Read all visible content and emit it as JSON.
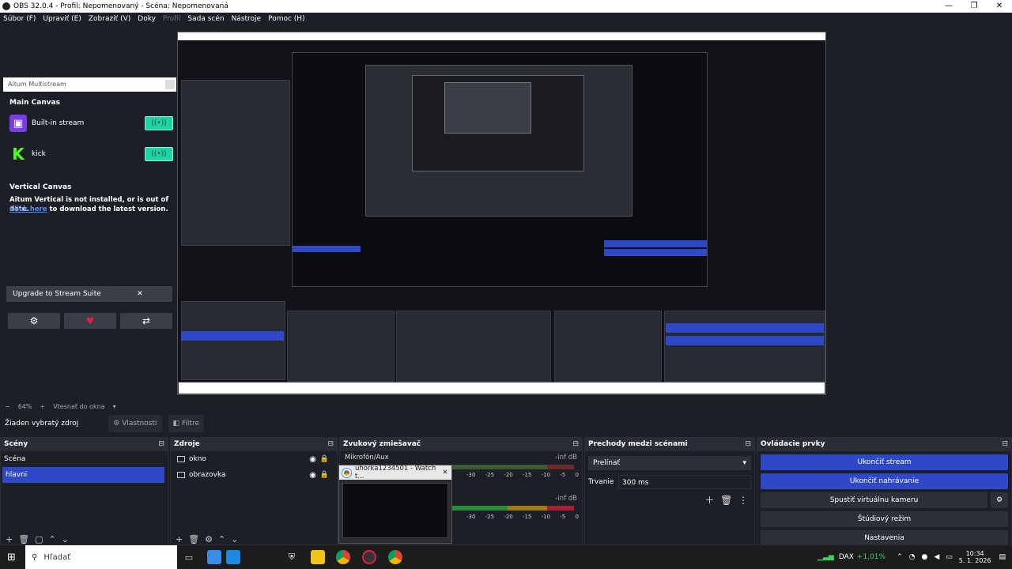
{
  "window": {
    "title": "OBS 32.0.4 - Profil: Nepomenovaný - Scéna: Nepomenovaná",
    "minimize": "—",
    "restore": "❐",
    "close": "✕"
  },
  "menu": [
    {
      "label": "Súbor (F)",
      "disabled": false
    },
    {
      "label": "Upraviť (E)",
      "disabled": false
    },
    {
      "label": "Zobraziť (V)",
      "disabled": false
    },
    {
      "label": "Doky",
      "disabled": false
    },
    {
      "label": "Profil",
      "disabled": true
    },
    {
      "label": "Sada scén",
      "disabled": false
    },
    {
      "label": "Nástroje",
      "disabled": false
    },
    {
      "label": "Pomoc (H)",
      "disabled": false
    }
  ],
  "aitum": {
    "header": "Aitum Multistream",
    "main_canvas": "Main Canvas",
    "streams": [
      {
        "name": "Built-in stream",
        "icon": "twitch-icon",
        "glyph": "▣"
      },
      {
        "name": "kick",
        "icon": "kick-icon",
        "glyph": "K"
      }
    ],
    "toggle_glyph": "((•))",
    "vertical_canvas": "Vertical Canvas",
    "vertical_note": "Aitum Vertical is not installed, or is out of date.",
    "link_text": "Click here",
    "link_suffix": " to download the latest version.",
    "upgrade_button": "Upgrade to Stream Suite",
    "close_glyph": "✕",
    "settings_glyph": "⚙",
    "heart_glyph": "♥",
    "share_glyph": "⇄"
  },
  "zoom": {
    "percent": "64%",
    "plus": "+",
    "fit": "Vtesnať do okna",
    "arrow": "▾",
    "minus": "−"
  },
  "source_bar": {
    "selected": "Žiaden vybratý zdroj",
    "properties": "Vlastnosti",
    "filters": "Filtre"
  },
  "scenes": {
    "title": "Scény",
    "items": [
      "Scéna",
      "hlavni"
    ],
    "selected_index": 1
  },
  "sources": {
    "title": "Zdroje",
    "items": [
      "okno",
      "obrazovka"
    ]
  },
  "mixer": {
    "title": "Zvukový zmiešavač",
    "channel": "Mikrofón/Aux",
    "level_db": "-inf dB",
    "level_db2": "-inf dB",
    "ticks": [
      "-30",
      "-25",
      "-20",
      "-15",
      "-10",
      "-5",
      "0"
    ]
  },
  "transitions": {
    "title": "Prechody medzi scénami",
    "type": "Prelínať",
    "duration_label": "Trvanie",
    "duration_value": "300 ms"
  },
  "controls": {
    "title": "Ovládacie prvky",
    "buttons": [
      {
        "label": "Ukončiť stream",
        "active": true
      },
      {
        "label": "Ukončiť nahrávanie",
        "active": true
      },
      {
        "label": "Spustiť virtuálnu kameru",
        "active": false
      },
      {
        "label": "Štúdiový režim",
        "active": false
      },
      {
        "label": "Nastavenia",
        "active": false
      }
    ]
  },
  "popup": {
    "title": "uhorka1234501 - Watch t...",
    "close": "✕"
  },
  "taskbar": {
    "search_placeholder": "Hľadať",
    "stock_name": "DAX",
    "stock_change": "+1,01%",
    "time": "10:34",
    "date": "5. 1. 2026"
  },
  "colors": {
    "accent": "#2f48c8",
    "toggle": "#1fd3a5",
    "twitch": "#7b3ee6",
    "kick": "#53fc18",
    "stock_up": "#3fcf5f"
  }
}
